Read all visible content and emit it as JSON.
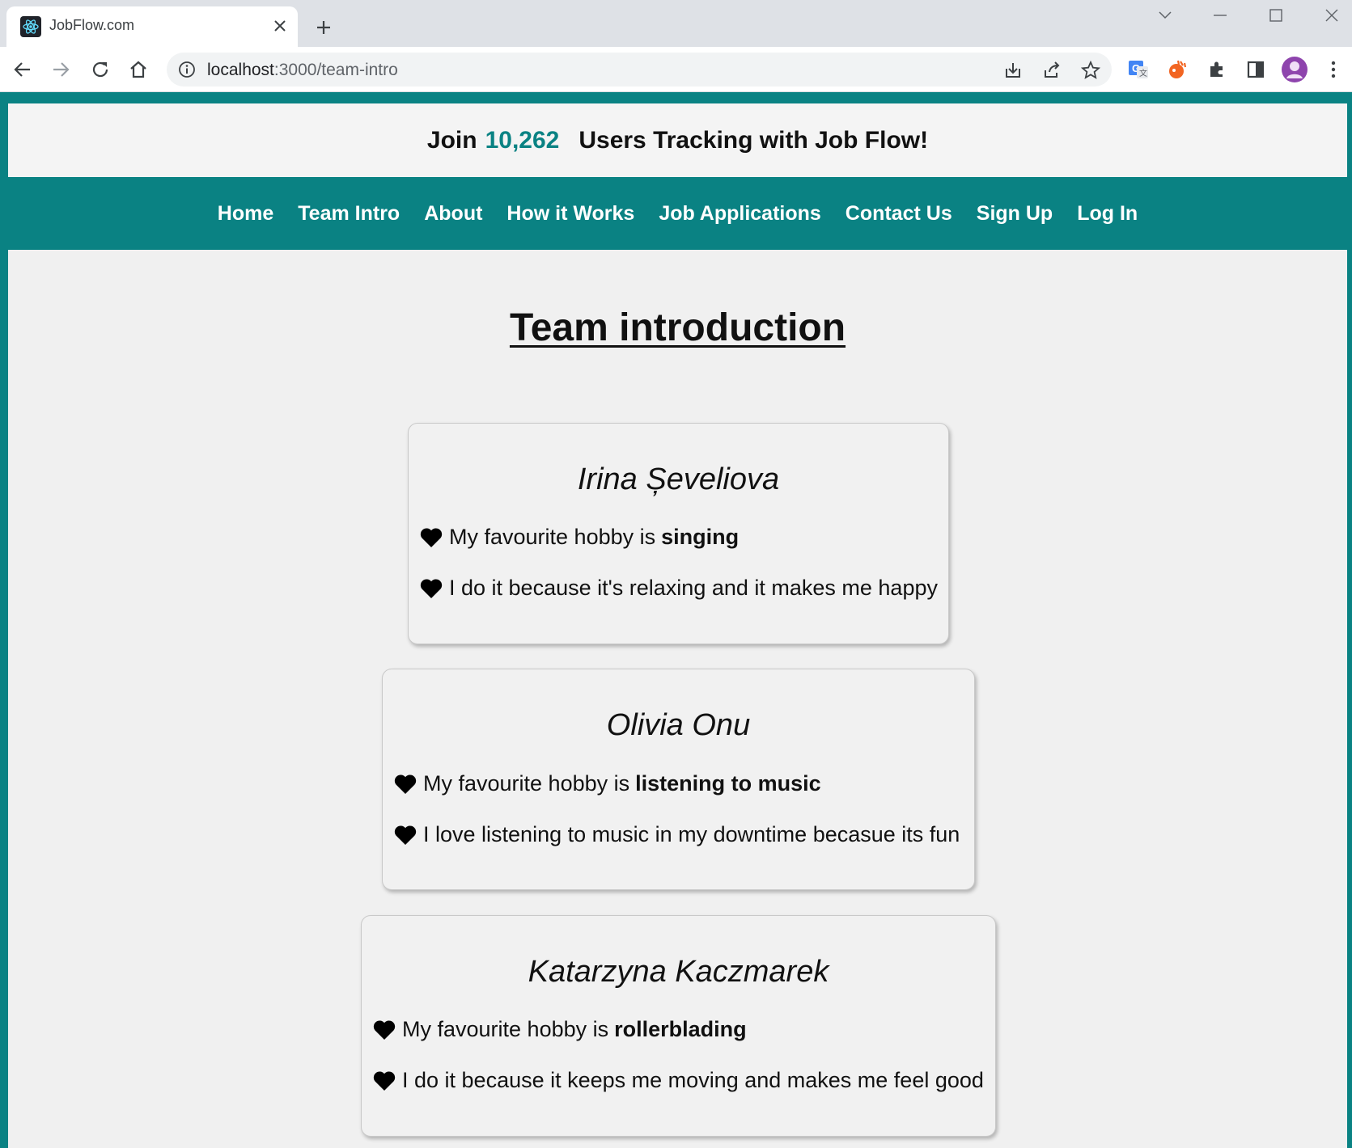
{
  "browser": {
    "tab_title": "JobFlow.com",
    "url_host": "localhost",
    "url_path": ":3000/team-intro"
  },
  "banner": {
    "prefix": "Join",
    "user_count": "10,262",
    "suffix": "Users Tracking with Job Flow!"
  },
  "nav": {
    "items": [
      {
        "label": "Home"
      },
      {
        "label": "Team Intro"
      },
      {
        "label": "About"
      },
      {
        "label": "How it Works"
      },
      {
        "label": "Job Applications"
      },
      {
        "label": "Contact Us"
      },
      {
        "label": "Sign Up"
      },
      {
        "label": "Log In"
      }
    ]
  },
  "page_title": "Team introduction",
  "team": [
    {
      "name": "Irina Șeveliova",
      "hobby_prefix": "My favourite hobby is",
      "hobby": "singing",
      "reason": "I do it because it's relaxing and it makes me happy"
    },
    {
      "name": "Olivia Onu",
      "hobby_prefix": "My favourite hobby is",
      "hobby": "listening to music",
      "reason": "I love listening to music in my downtime becasue its fun"
    },
    {
      "name": "Katarzyna Kaczmarek",
      "hobby_prefix": "My favourite hobby is",
      "hobby": "rollerblading",
      "reason": "I do it because it keeps me moving and makes me feel good"
    }
  ],
  "colors": {
    "accent": "#0a8283",
    "page_bg": "#f0f0f0"
  },
  "icons": {
    "list_bullet": "heart-icon"
  }
}
